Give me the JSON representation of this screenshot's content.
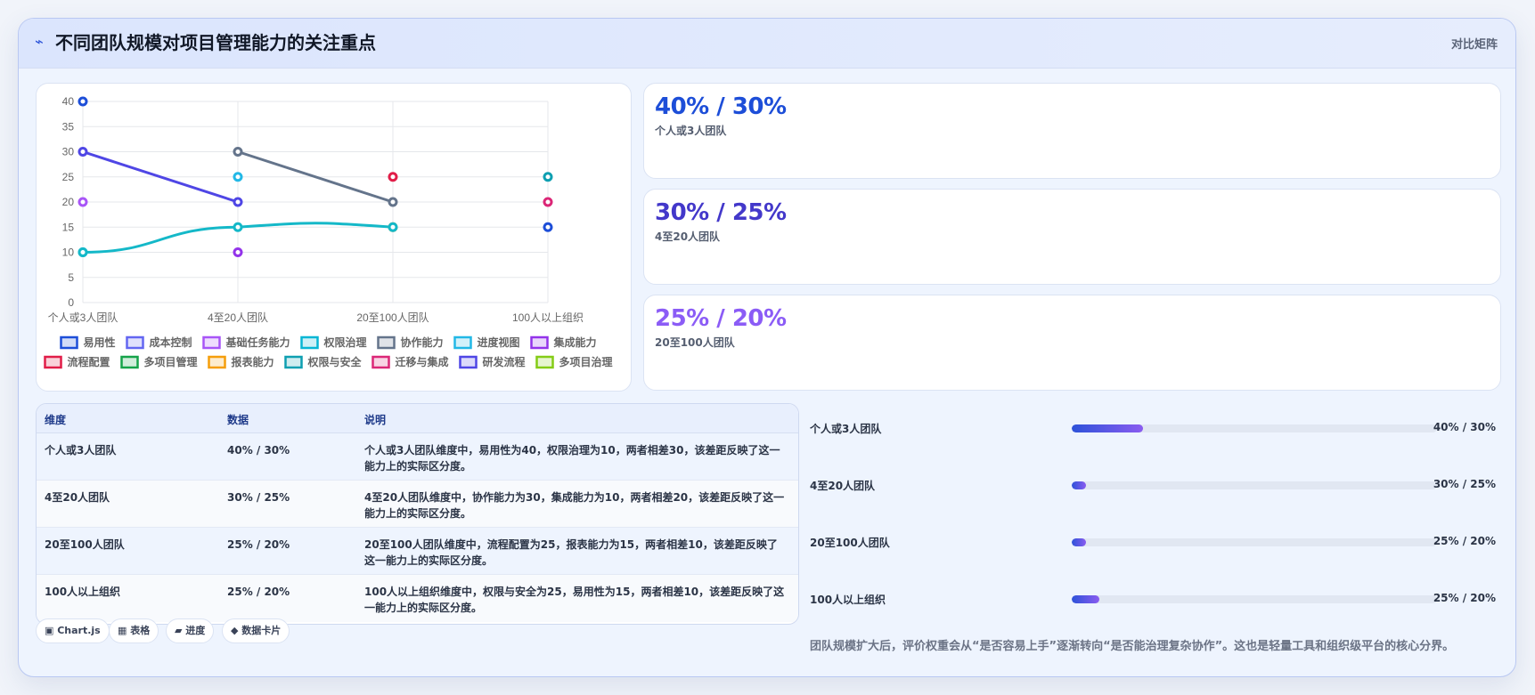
{
  "header": {
    "title": "不同团队规模对项目管理能力的关注重点",
    "tag": "对比矩阵",
    "icon": "flash-icon"
  },
  "chart_data": {
    "type": "line",
    "categories": [
      "个人或3人团队",
      "4至20人团队",
      "20至100人团队",
      "100人以上组织"
    ],
    "ylim": [
      0,
      40
    ],
    "yticks": [
      0,
      5,
      10,
      15,
      20,
      25,
      30,
      35,
      40
    ],
    "series": [
      {
        "name": "易用性",
        "color": "#1d4ed8",
        "values": [
          40,
          null,
          null,
          15
        ]
      },
      {
        "name": "成本控制",
        "color": "#6366f1",
        "values": [
          null,
          null,
          null,
          null
        ]
      },
      {
        "name": "基础任务能力",
        "color": "#a855f7",
        "values": [
          20,
          null,
          null,
          null
        ]
      },
      {
        "name": "权限治理",
        "color": "#06b6d4",
        "values": [
          10,
          null,
          null,
          null
        ]
      },
      {
        "name": "协作能力",
        "color": "#64748b",
        "values": [
          null,
          30,
          20,
          null
        ]
      },
      {
        "name": "进度视图",
        "color": "#22b8e6",
        "values": [
          null,
          25,
          null,
          null
        ]
      },
      {
        "name": "集成能力",
        "color": "#9333ea",
        "values": [
          null,
          10,
          null,
          null
        ]
      },
      {
        "name": "流程配置",
        "color": "#e11d48",
        "values": [
          null,
          null,
          25,
          null
        ]
      },
      {
        "name": "多项目管理",
        "color": "#16a34a",
        "values": [
          null,
          null,
          null,
          null
        ]
      },
      {
        "name": "报表能力",
        "color": "#f59e0b",
        "values": [
          null,
          null,
          15,
          null
        ]
      },
      {
        "name": "权限与安全",
        "color": "#0e9fb1",
        "values": [
          null,
          null,
          null,
          25
        ]
      },
      {
        "name": "迁移与集成",
        "color": "#db2777",
        "values": [
          null,
          null,
          null,
          20
        ]
      },
      {
        "name": "研发流程",
        "color": "#4f46e5",
        "values": [
          30,
          20,
          null,
          null
        ]
      },
      {
        "name": "多项目治理",
        "color": "#84cc16",
        "values": [
          null,
          null,
          null,
          null
        ]
      },
      {
        "name": "",
        "color": "#14b8c8",
        "values": [
          10,
          15,
          15,
          null
        ]
      }
    ],
    "grid": true,
    "legend_position": "bottom"
  },
  "stat_cards": [
    {
      "value": "40% / 30%",
      "label": "个人或3人团队",
      "color": "#1d4ed8"
    },
    {
      "value": "30% / 25%",
      "label": "4至20人团队",
      "color": "#4338ca"
    },
    {
      "value": "25% / 20%",
      "label": "20至100人团队",
      "color": "#8b5cf6"
    }
  ],
  "table": {
    "headers": [
      "维度",
      "数据",
      "说明"
    ],
    "rows": [
      {
        "dim": "个人或3人团队",
        "data": "40% / 30%",
        "desc": "个人或3人团队维度中，易用性为40，权限治理为10，两者相差30，该差距反映了这一能力上的实际区分度。"
      },
      {
        "dim": "4至20人团队",
        "data": "30% / 25%",
        "desc": "4至20人团队维度中，协作能力为30，集成能力为10，两者相差20，该差距反映了这一能力上的实际区分度。"
      },
      {
        "dim": "20至100人团队",
        "data": "25% / 20%",
        "desc": "20至100人团队维度中，流程配置为25，报表能力为15，两者相差10，该差距反映了这一能力上的实际区分度。"
      },
      {
        "dim": "100人以上组织",
        "data": "25% / 20%",
        "desc": "100人以上组织维度中，权限与安全为25，易用性为15，两者相差10，该差距反映了这一能力上的实际区分度。"
      }
    ]
  },
  "chips": [
    {
      "label": "▣ Chart.js",
      "icon": "chart-icon"
    },
    {
      "label": "▦ 表格",
      "icon": "table-icon"
    },
    {
      "label": "▰ 进度",
      "icon": "progress-icon"
    },
    {
      "label": "◆ 数据卡片",
      "icon": "card-icon"
    }
  ],
  "progress": [
    {
      "label": "个人或3人团队",
      "value": "40% / 30%",
      "fill": 0.195
    },
    {
      "label": "4至20人团队",
      "value": "30% / 25%",
      "fill": 0.04
    },
    {
      "label": "20至100人团队",
      "value": "25% / 20%",
      "fill": 0.04
    },
    {
      "label": "100人以上组织",
      "value": "25% / 20%",
      "fill": 0.075
    }
  ],
  "note": "团队规模扩大后，评价权重会从“是否容易上手”逐渐转向“是否能治理复杂协作”。这也是轻量工具和组织级平台的核心分界。"
}
